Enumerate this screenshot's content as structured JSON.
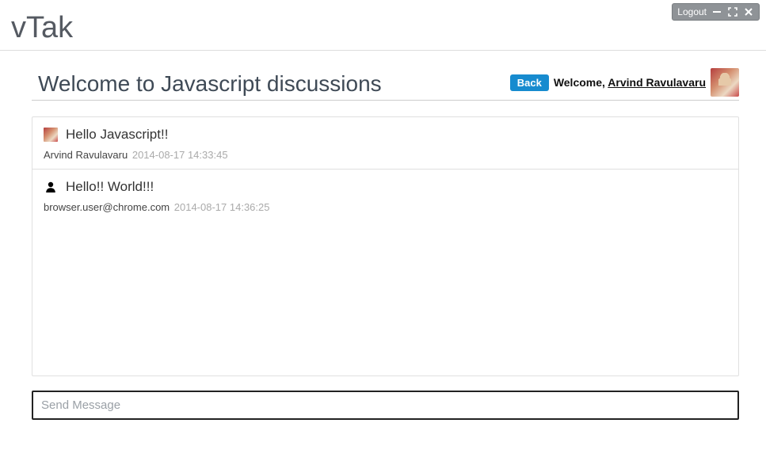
{
  "toolbar": {
    "logout_label": "Logout"
  },
  "app": {
    "title": "vTak"
  },
  "header": {
    "room_title": "Welcome to Javascript discussions",
    "back_label": "Back",
    "welcome_prefix": "Welcome, ",
    "user_name": "Arvind Ravulavaru"
  },
  "messages": [
    {
      "icon": "avatar",
      "text": "Hello Javascript!!",
      "author": "Arvind Ravulavaru",
      "time": "2014-08-17 14:33:45"
    },
    {
      "icon": "user-glyph",
      "text": "Hello!! World!!!",
      "author": "browser.user@chrome.com",
      "time": "2014-08-17 14:36:25"
    }
  ],
  "composer": {
    "placeholder": "Send Message",
    "value": ""
  }
}
